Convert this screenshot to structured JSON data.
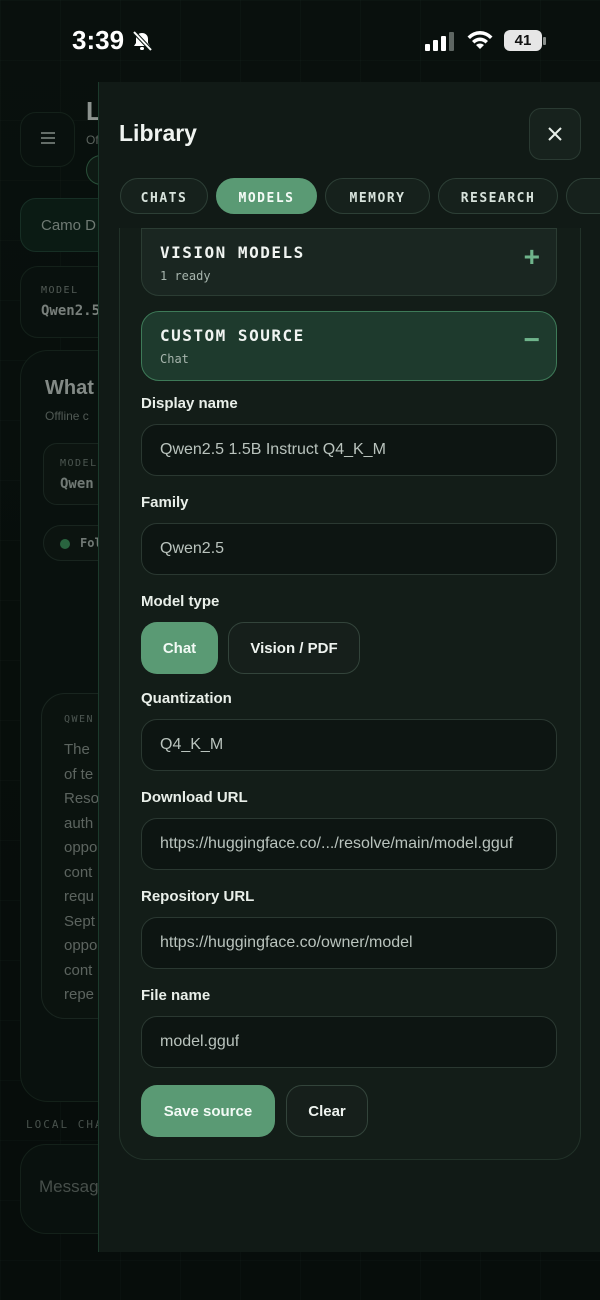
{
  "status_bar": {
    "time": "3:39",
    "battery": "41"
  },
  "background": {
    "title_initial": "L",
    "subtitle_initial": "Of",
    "menu_icon": "menu-icon",
    "chip_label": "Camo D",
    "model_caption": "MODEL",
    "model_value": "Qwen2.5",
    "card_title": "What",
    "card_subtitle": "Offline c",
    "inner_caption": "MODEL",
    "inner_value": "Qwen",
    "status_text": "Fol",
    "message_caption": "QWEN",
    "message_lines": [
      "The",
      "of te",
      "Reso",
      "auth",
      "oppo",
      "cont",
      "requ",
      "Sept",
      "oppo",
      "cont",
      "repe"
    ],
    "section_caption": "LOCAL CHA",
    "composer_placeholder": "Messag"
  },
  "drawer": {
    "title": "Library",
    "close_icon": "close-icon",
    "tabs": [
      {
        "label": "CHATS",
        "active": false
      },
      {
        "label": "MODELS",
        "active": true
      },
      {
        "label": "MEMORY",
        "active": false
      },
      {
        "label": "RESEARCH",
        "active": false
      }
    ],
    "sections": [
      {
        "title": "VISION MODELS",
        "subtitle": "1 ready",
        "state": "+"
      },
      {
        "title": "CUSTOM SOURCE",
        "subtitle": "Chat",
        "state": "−"
      }
    ],
    "form": {
      "display_name": {
        "label": "Display name",
        "value": "Qwen2.5 1.5B Instruct Q4_K_M"
      },
      "family": {
        "label": "Family",
        "value": "Qwen2.5"
      },
      "model_type": {
        "label": "Model type",
        "options": [
          "Chat",
          "Vision / PDF"
        ],
        "selected": "Chat"
      },
      "quantization": {
        "label": "Quantization",
        "value": "Q4_K_M"
      },
      "download_url": {
        "label": "Download URL",
        "value": "https://huggingface.co/.../resolve/main/model.gguf"
      },
      "repository_url": {
        "label": "Repository URL",
        "value": "https://huggingface.co/owner/model"
      },
      "file_name": {
        "label": "File name",
        "value": "model.gguf"
      },
      "save_label": "Save source",
      "clear_label": "Clear"
    }
  },
  "colors": {
    "accent": "#5a9a74",
    "background": "#0b1512",
    "panel": "#131d18"
  }
}
